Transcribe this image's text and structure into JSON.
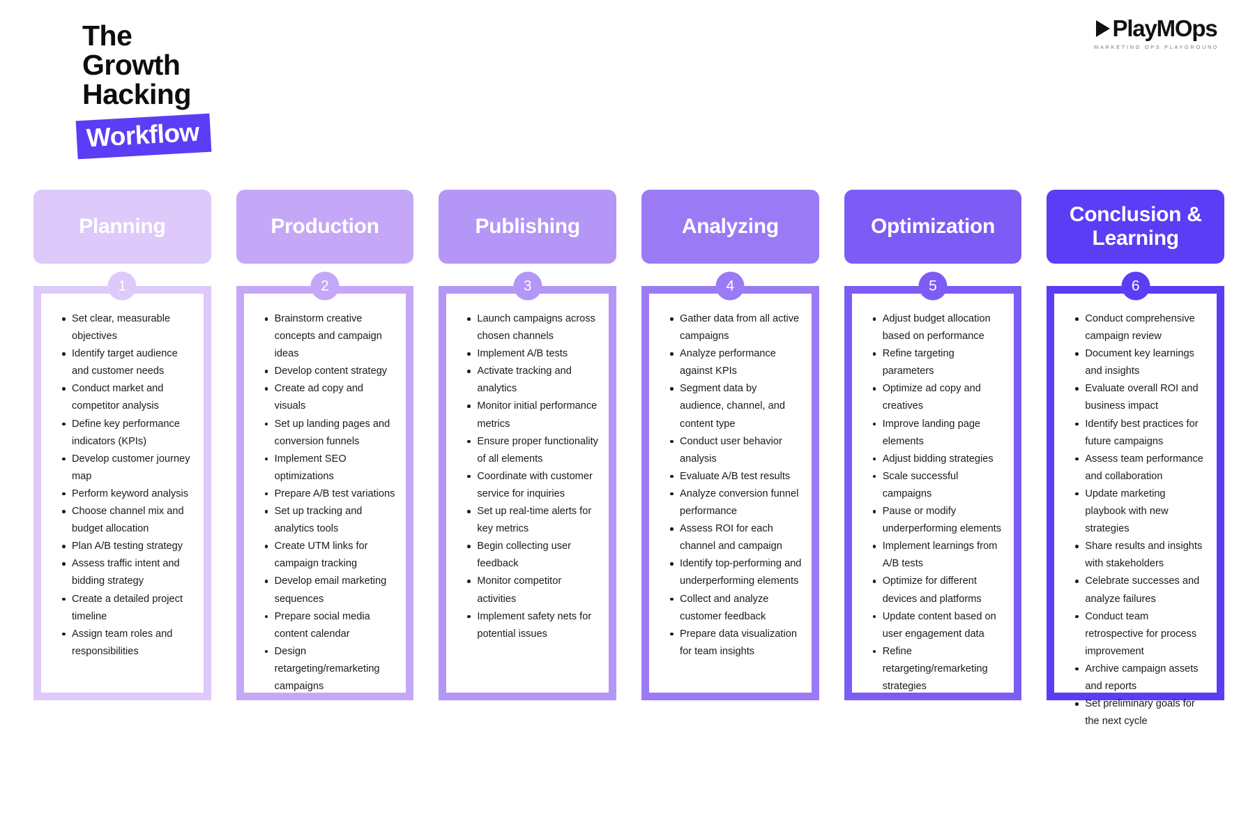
{
  "header": {
    "title_lines": [
      "The",
      "Growth",
      "Hacking"
    ],
    "badge_label": "Workflow",
    "badge_color": "#5b3df5"
  },
  "logo": {
    "icon": "play-triangle-icon",
    "wordmark": "PlayMOps",
    "tagline": "MARKETING OPS PLAYGROUND"
  },
  "columns": [
    {
      "number": "1",
      "title": "Planning",
      "color": "#ddc9fa",
      "items": [
        "Set clear, measurable objectives",
        "Identify target audience and customer needs",
        "Conduct market and competitor analysis",
        "Define key performance indicators (KPIs)",
        "Develop customer journey map",
        "Perform keyword analysis",
        "Choose channel mix and budget allocation",
        "Plan A/B testing strategy",
        "Assess traffic intent and bidding strategy",
        "Create a detailed project timeline",
        "Assign team roles and responsibilities"
      ]
    },
    {
      "number": "2",
      "title": "Production",
      "color": "#c4a8f7",
      "items": [
        "Brainstorm creative concepts and campaign ideas",
        "Develop content strategy",
        "Create ad copy and visuals",
        "Set up landing pages and conversion funnels",
        "Implement SEO optimizations",
        "Prepare A/B test variations",
        "Set up tracking and analytics tools",
        "Create UTM links for campaign tracking",
        "Develop email marketing sequences",
        "Prepare social media content calendar",
        "Design retargeting/remarketing campaigns"
      ]
    },
    {
      "number": "3",
      "title": "Publishing",
      "color": "#b496f6",
      "items": [
        "Launch campaigns across chosen channels",
        "Implement A/B tests",
        "Activate tracking and analytics",
        "Monitor initial performance metrics",
        "Ensure proper functionality of all elements",
        "Coordinate with customer service for inquiries",
        "Set up real-time alerts for key metrics",
        "Begin collecting user feedback",
        "Monitor competitor activities",
        "Implement safety nets for potential issues"
      ]
    },
    {
      "number": "4",
      "title": "Analyzing",
      "color": "#9a7bf5",
      "items": [
        "Gather data from all active campaigns",
        "Analyze performance against KPIs",
        "Segment data by audience, channel, and content type",
        "Conduct user behavior analysis",
        "Evaluate A/B test results",
        "Analyze conversion funnel performance",
        "Assess ROI for each channel and campaign",
        "Identify top-performing and underperforming elements",
        "Collect and analyze customer feedback",
        "Prepare data visualization for team insights"
      ]
    },
    {
      "number": "5",
      "title": "Optimization",
      "color": "#7c5cf5",
      "items": [
        "Adjust budget allocation based on performance",
        "Refine targeting parameters",
        "Optimize ad copy and creatives",
        "Improve landing page elements",
        "Adjust bidding strategies",
        "Scale successful campaigns",
        "Pause or modify underperforming elements",
        "Implement learnings from A/B tests",
        "Optimize for different devices and platforms",
        "Update content based on user engagement data",
        "Refine retargeting/remarketing strategies"
      ]
    },
    {
      "number": "6",
      "title": "Conclusion & Learning",
      "color": "#5b3df5",
      "items": [
        "Conduct comprehensive campaign review",
        "Document key learnings and insights",
        "Evaluate overall ROI and business impact",
        "Identify best practices for future campaigns",
        "Assess team performance and collaboration",
        "Update marketing playbook with new strategies",
        "Share results and insights with stakeholders",
        "Celebrate successes and analyze failures",
        "Conduct team retrospective for process improvement",
        "Archive campaign assets and reports",
        "Set preliminary goals for the next cycle"
      ]
    }
  ]
}
